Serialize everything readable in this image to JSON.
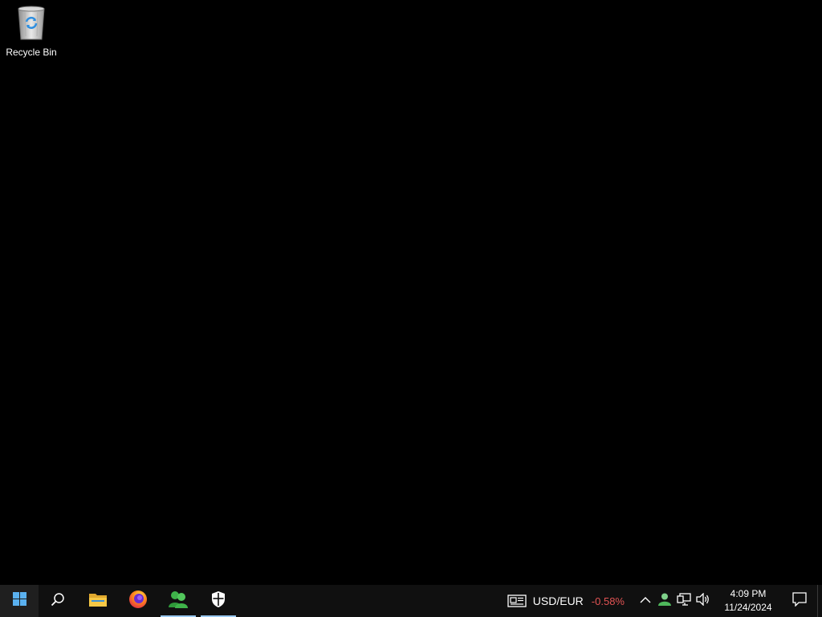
{
  "desktop": {
    "background_color": "#000000",
    "icons": [
      {
        "label": "Recycle Bin",
        "icon": "recycle-bin-icon"
      }
    ]
  },
  "taskbar": {
    "start_button": {
      "icon": "windows-logo-icon"
    },
    "search_button": {
      "icon": "search-icon"
    },
    "pinned": [
      {
        "name": "File Explorer",
        "icon": "folder-icon",
        "running": false
      },
      {
        "name": "Firefox",
        "icon": "firefox-icon",
        "running": false
      },
      {
        "name": "Users app",
        "icon": "users-icon",
        "running": true
      },
      {
        "name": "Windows Security",
        "icon": "shield-icon",
        "running": true
      }
    ],
    "widget": {
      "icon": "news-icon",
      "pair": "USD/EUR",
      "change": "-0.58%",
      "change_color": "#e35454"
    },
    "tray": {
      "overflow_icon": "chevron-up-icon",
      "icons": [
        "user-status-icon",
        "network-icon",
        "volume-icon"
      ]
    },
    "clock": {
      "time": "4:09 PM",
      "date": "11/24/2024"
    },
    "notification_icon": "action-center-icon"
  }
}
